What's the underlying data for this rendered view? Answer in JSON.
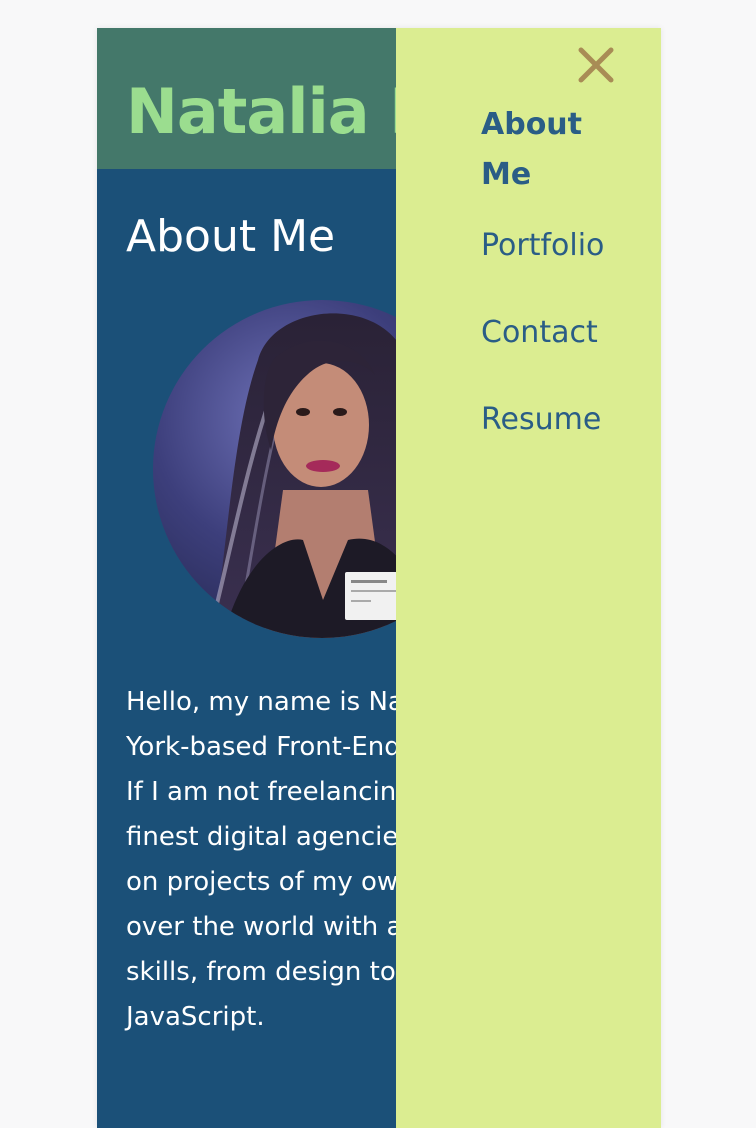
{
  "header": {
    "title": "Natalia Pelaez"
  },
  "about": {
    "heading": "About Me",
    "bio": "Hello, my name is Natalia. I am a New York-based Front-End Web Developer. If I am not freelancing at some of the finest digital agencies, I am working on projects of my own for clients all over the world with a diverse set of skills, from design to HTML + CSS and JavaScript."
  },
  "menu": {
    "close_icon": "close-icon",
    "items": [
      {
        "label": "About Me",
        "active": true
      },
      {
        "label": "Portfolio",
        "active": false
      },
      {
        "label": "Contact",
        "active": false
      },
      {
        "label": "Resume",
        "active": false
      }
    ]
  },
  "colors": {
    "header_bg": "#44786a",
    "title": "#9bdd8f",
    "page_bg": "#1b5078",
    "menu_bg": "#dbed91",
    "menu_text": "#2a5d86",
    "close_icon": "#a88c55"
  }
}
